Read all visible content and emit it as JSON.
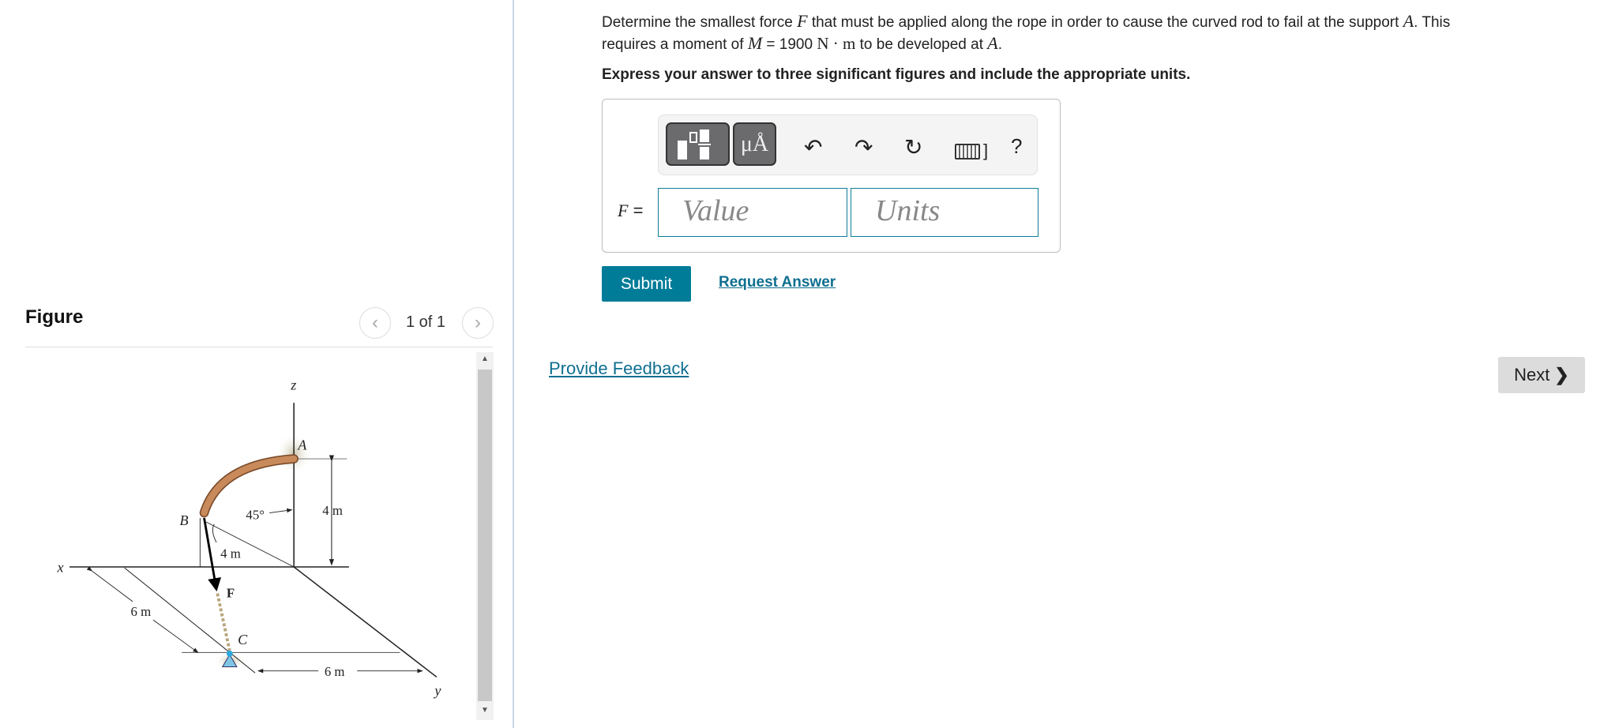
{
  "figure": {
    "title": "Figure",
    "pager": "1 of 1",
    "prev_icon": "chevron-left-icon",
    "next_icon": "chevron-right-icon",
    "labels": {
      "z": "z",
      "x": "x",
      "y": "y",
      "A": "A",
      "B": "B",
      "C": "C",
      "F": "F",
      "angle": "45°",
      "dim_4m_vertical": "4 m",
      "dim_4m_rod": "4 m",
      "dim_6m_left": "6 m",
      "dim_6m_bottom": "6 m"
    },
    "rod_color": "#c88a5a"
  },
  "question": {
    "line1_a": "Determine the smallest force ",
    "var_F": "F",
    "line1_b": " that must be applied along the rope in order to cause the curved rod to fail at the support ",
    "var_A": "A",
    "line1_c": ". This",
    "line2_a": "requires a moment of ",
    "var_M": "M",
    "line2_b": " = 1900 ",
    "unit": "N · m",
    "line2_c": " to be developed at ",
    "line2_d": ".",
    "instruction": "Express your answer to three significant figures and include the appropriate units."
  },
  "answer": {
    "label": "F",
    "equals": " =",
    "value_placeholder": "Value",
    "units_placeholder": "Units",
    "toolbar": {
      "templates_icon": "templates-icon",
      "units_label": "μÅ",
      "undo": "undo-icon",
      "redo": "redo-icon",
      "reset": "reset-icon",
      "keyboard": "keyboard-icon",
      "help": "?"
    }
  },
  "actions": {
    "submit": "Submit",
    "request": "Request Answer",
    "feedback": "Provide Feedback",
    "next": "Next"
  },
  "colors": {
    "accent": "#007c99",
    "link": "#0f6f90"
  }
}
